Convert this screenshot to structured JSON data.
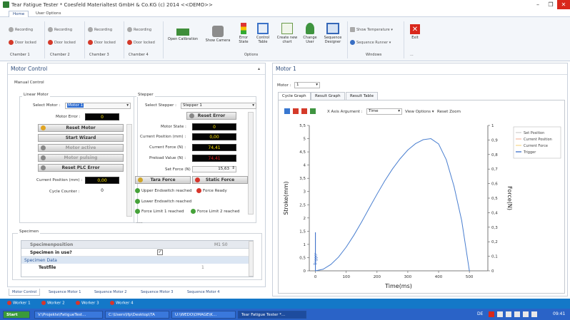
{
  "window": {
    "title": "Tear Fatigue Tester * Coesfeld Materialtest GmbH & Co.KG (c) 2014 <<DEMO>>",
    "min": "–",
    "restore": "❐",
    "close": "✕"
  },
  "menu": {
    "tabs": [
      "Home",
      "User Options"
    ]
  },
  "ribbon": {
    "channels": [
      {
        "recording": "Recording",
        "door": "Door locked",
        "group": "Chamber 1"
      },
      {
        "recording": "Recording",
        "door": "Door locked",
        "group": "Chamber 2"
      },
      {
        "recording": "Recording",
        "door": "Door locked",
        "group": "Chamber 3"
      },
      {
        "recording": "Recording",
        "door": "Door locked",
        "group": "Chamber 4"
      }
    ],
    "options": [
      "Open Calibration",
      "Show Camera",
      "Error State",
      "Control Table",
      "Create new chart",
      "Change User",
      "Sequence Designer"
    ],
    "options_group": "Options",
    "windows": {
      "show_temperature": "Show Temperature",
      "sequence_runner": "Sequence Runner",
      "group": "Windows"
    },
    "exit": "Exit",
    "more_group": "..."
  },
  "motor_control": {
    "title": "Motor Control",
    "pin": "▴",
    "manual_control": "Manual Control",
    "linear_motor": {
      "legend": "Linear Motor",
      "select_label": "Select Motor :",
      "select_value": "Motor 1",
      "error_label": "Motor Error :",
      "error_value": "0",
      "buttons": [
        "Reset Motor",
        "Start Wizard",
        "Motor active",
        "Motor pulsing",
        "Reset PLC Error"
      ],
      "position_label": "Current Position (mm) :",
      "position_value": "0,00",
      "cycle_label": "Cycle Counter :",
      "cycle_value": "0"
    },
    "stepper": {
      "legend": "Stepper",
      "select_label": "Select Stepper :",
      "select_value": "Stepper 1",
      "reset_error": "Reset Error",
      "motor_state_label": "Motor State :",
      "motor_state_value": "0",
      "position_label": "Current Position (mm) :",
      "position_value": "0,00",
      "force_label": "Current Force (N) :",
      "force_value": "74,41",
      "preload_label": "Preload Value (N) :",
      "preload_value": "74,41",
      "setforce_label": "Set Force (N) :",
      "setforce_value": "15,63",
      "tara_force": "Tara Force",
      "static_force": "Static Force",
      "status": [
        "Upper Endswitch reached",
        "Force Ready",
        "Lower Endswitch reached",
        "Force Limit 1 reached",
        "Force Limit 2 reached"
      ],
      "dots": "....."
    },
    "specimen": {
      "legend": "Specimen",
      "table": {
        "name": "Specimenposition",
        "pos": "M1 S0",
        "in_use": "Specimen in use?",
        "group": "Specimen Data",
        "testfile": "Testfile",
        "testfile_val": "1"
      }
    }
  },
  "bottom_tabs": [
    "Motor Control",
    "Sequence Motor 1",
    "Sequence Motor 2",
    "Sequence Motor 3",
    "Sequence Motor 4"
  ],
  "motor_panel": {
    "title": "Motor 1",
    "motor_label": "Motor :",
    "motor_value": "1",
    "tabs": [
      "Cycle Graph",
      "Result Graph",
      "Result Table"
    ],
    "toolbar": {
      "xaxis_label": "X Axis Argument :",
      "xaxis_value": "Time",
      "view_options": "View Options ▾",
      "reset_zoom": "Reset Zoom"
    }
  },
  "chart_data": {
    "type": "line",
    "xlabel": "Time(ms)",
    "ylabel": "Stroke(mm)",
    "y2label": "Force(N)",
    "xlim": [
      -20,
      560
    ],
    "ylim": [
      0,
      5.5
    ],
    "y2lim": [
      0,
      1
    ],
    "xticks": [
      "0",
      "100",
      "200",
      "300",
      "400",
      "500"
    ],
    "yticks": [
      "0",
      "0,5",
      "1",
      "1,5",
      "2",
      "2,5",
      "3",
      "3,5",
      "4",
      "4,5",
      "5",
      "5,5"
    ],
    "y2ticks": [
      "0",
      "0,1",
      "0,2",
      "0,3",
      "0,4",
      "0,5",
      "0,6",
      "0,7",
      "0,8",
      "0,9",
      "1"
    ],
    "grid": false,
    "legend_position": "top-right",
    "legend": [
      "Set Position",
      "Current Position",
      "Current Force",
      "Trigger"
    ],
    "trigger_label": "Trigger",
    "series": [
      {
        "name": "Set Position",
        "color": "#4a7fd0",
        "x": [
          0,
          25,
          50,
          75,
          100,
          125,
          150,
          175,
          200,
          225,
          250,
          275,
          300,
          325,
          350,
          375,
          400,
          425,
          450,
          475,
          500
        ],
        "y": [
          0,
          0.06,
          0.24,
          0.52,
          0.9,
          1.35,
          1.85,
          2.38,
          2.9,
          3.4,
          3.85,
          4.24,
          4.57,
          4.81,
          4.96,
          5.0,
          4.8,
          4.2,
          3.2,
          1.9,
          0
        ]
      }
    ]
  },
  "workers": [
    "Worker 1",
    "Worker 2",
    "Worker 3",
    "Worker 4"
  ],
  "taskbar": {
    "start": "Start",
    "items": [
      "V:\\Projekte\\FatigueTest...",
      "C:\\Users\\lfp\\Desktop\\TA",
      "U:\\WEDO\\DMAGE\\K...",
      "Tear Fatigue Tester *..."
    ],
    "lang": "DE",
    "time": "09:41"
  }
}
